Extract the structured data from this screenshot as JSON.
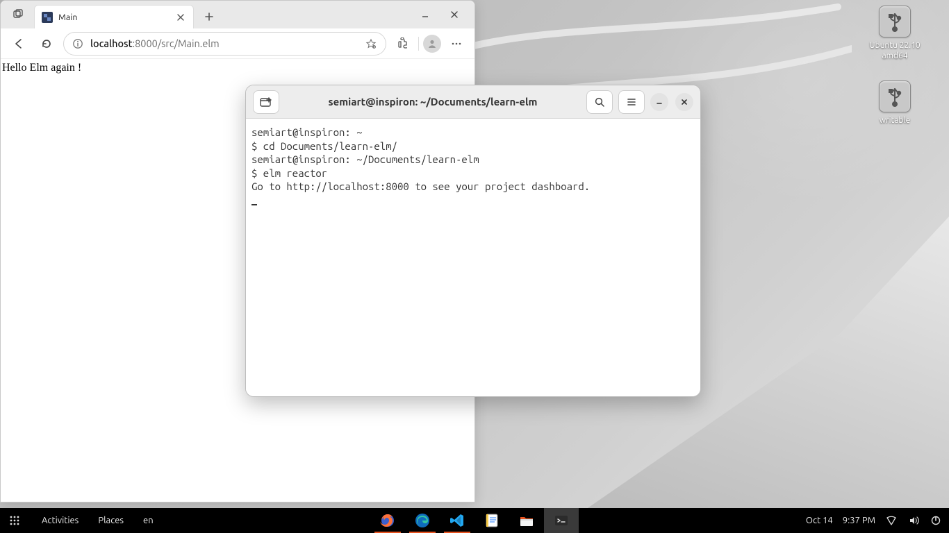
{
  "desktop": {
    "icons": [
      {
        "label": "Ubuntu 22.10\namd64"
      },
      {
        "label": "writable"
      }
    ]
  },
  "browser": {
    "tab_title": "Main",
    "url_host": "localhost",
    "url_rest": ":8000/src/Main.elm",
    "page_text": "Hello Elm again !"
  },
  "terminal": {
    "title": "semiart@inspiron: ~/Documents/learn-elm",
    "lines": [
      "semiart@inspiron: ~",
      "$ cd Documents/learn-elm/",
      "semiart@inspiron: ~/Documents/learn-elm",
      "$ elm reactor",
      "Go to http://localhost:8000 to see your project dashboard."
    ]
  },
  "panel": {
    "activities": "Activities",
    "places": "Places",
    "lang": "en",
    "date": "Oct 14",
    "time": "9:37 PM"
  }
}
